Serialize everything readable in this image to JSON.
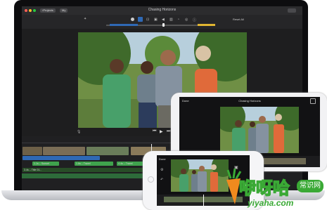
{
  "mac": {
    "back_button": "Projects",
    "window_title": "Chasing Horizons",
    "media_tab": "My",
    "reset_label": "Reset All",
    "timeline_clip_1": "1.1s – Sunset",
    "timeline_clip_2": "1.6s – Travel",
    "timeline_clip_3": "4.4s – Travel",
    "audio_label": "3.4s – Title 01..."
  },
  "ipad": {
    "done_label": "Done",
    "title": "Chasing Horizons"
  },
  "iphone": {
    "done_label": "Done"
  },
  "watermark": {
    "brand_cn": "咿呀哈",
    "badge_cn": "常识网",
    "url": "yiyaha.com"
  },
  "colors": {
    "accent": "#2f69b5",
    "clip_green": "#3fa34d",
    "watermark_green": "#3aa935"
  }
}
